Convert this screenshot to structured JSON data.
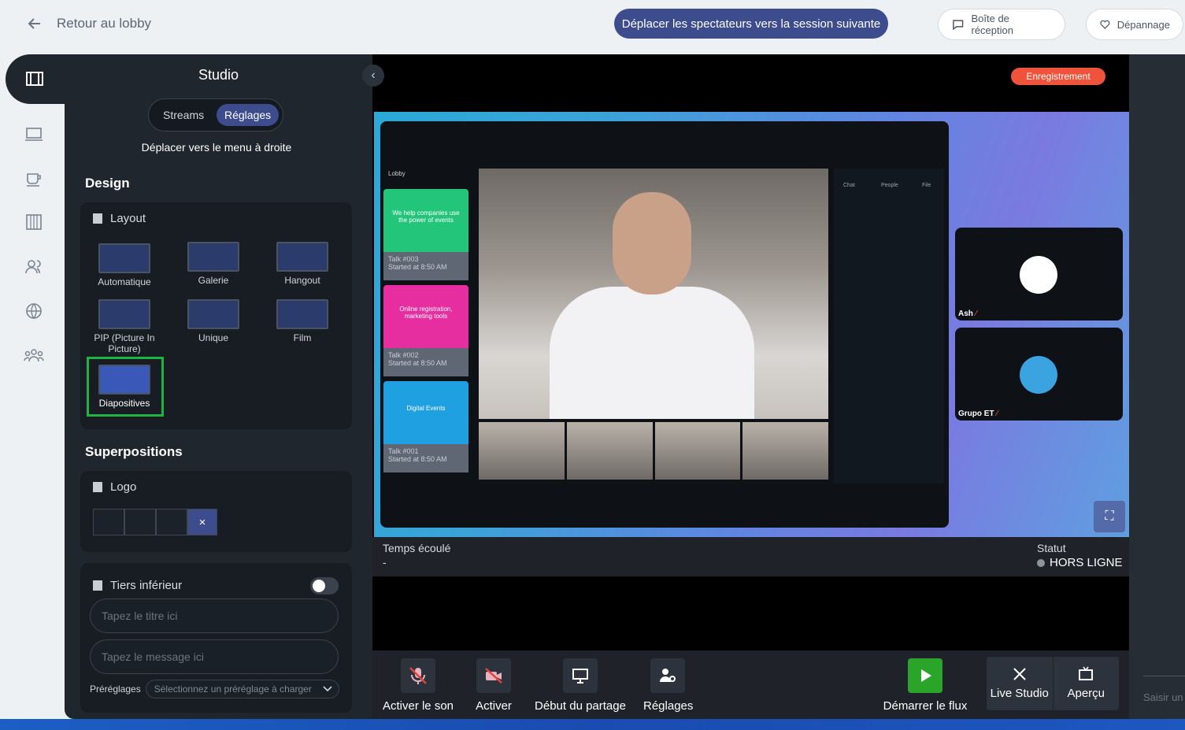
{
  "topbar": {
    "back_label": "Retour au lobby",
    "move_viewers_button": "Déplacer les spectateurs vers la session suivante",
    "inbox_button": "Boîte de réception",
    "troubleshoot_button": "Dépannage"
  },
  "studio": {
    "title": "Studio",
    "tabs": [
      "Streams",
      "Réglages"
    ],
    "active_tab": "Réglages",
    "move_menu_text": "Déplacer vers le menu à droite",
    "design_title": "Design",
    "layout_title": "Layout",
    "layouts": [
      "Automatique",
      "Galerie",
      "Hangout",
      "PIP (Picture In Picture)",
      "Unique",
      "Film",
      "Diapositives"
    ],
    "selected_layout": "Diapositives",
    "overlays_title": "Superpositions",
    "logo_title": "Logo",
    "logo_clear_glyph": "×",
    "lower_third_title": "Tiers inférieur",
    "lower_third_enabled": false,
    "title_placeholder": "Tapez le titre ici",
    "message_placeholder": "Tapez le message ici",
    "presets_label": "Préréglages",
    "presets_placeholder": "Sélectionnez un préréglage à charger"
  },
  "stage": {
    "recording_badge": "Enregistrement",
    "participants": [
      {
        "name": "Ash",
        "muted": true
      },
      {
        "name": "Grupo ET",
        "muted": true
      }
    ],
    "elapsed_label": "Temps écoulé",
    "elapsed_value": "-",
    "status_label": "Statut",
    "status_value": "HORS LIGNE"
  },
  "slide": {
    "lobby_label": "Lobby",
    "talks": [
      {
        "banner": "We help companies use the power of events",
        "title": "Talk #003",
        "sub": "Started at 8:50 AM",
        "color": "#23c57a"
      },
      {
        "banner": "Online registration, marketing tools",
        "title": "Talk #002",
        "sub": "Started at 8:50 AM",
        "color": "#e62ea0"
      },
      {
        "banner": "Digital Events",
        "title": "Talk #001",
        "sub": "Started at 8:50 AM",
        "color": "#1fa0e0"
      }
    ],
    "chat_tabs": [
      "Chat",
      "People",
      "File"
    ]
  },
  "controls": {
    "unmute": "Activer le son",
    "camera": "Activer",
    "share": "Début du partage",
    "settings": "Réglages",
    "start_stream": "Démarrer le flux",
    "live_studio": "Live Studio",
    "preview": "Aperçu"
  },
  "side_input_placeholder": "Saisir un",
  "colors": {
    "accent": "#3d4c8c",
    "recording": "#f0533b",
    "selected_outline": "#1fb442",
    "start_green": "#2aa52a"
  }
}
